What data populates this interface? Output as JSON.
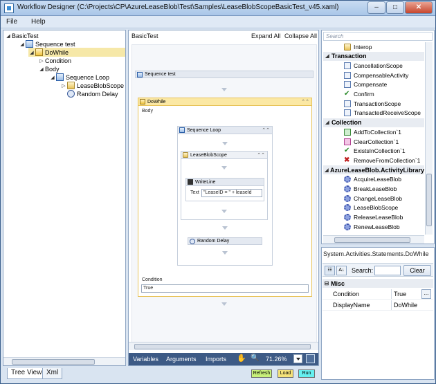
{
  "window": {
    "title": "Workflow Designer (C:\\Projects\\CP\\AzureLeaseBlob\\Test\\Samples\\LeaseBlobScopeBasicTest_v45.xaml)"
  },
  "window_controls": {
    "minimize": "–",
    "maximize": "□",
    "close": "✕"
  },
  "menu": [
    "File",
    "Help"
  ],
  "tree": {
    "items": [
      {
        "label": "BasicTest"
      },
      {
        "label": "Sequence test"
      },
      {
        "label": "DoWhile"
      },
      {
        "label": "Condition"
      },
      {
        "label": "Body"
      },
      {
        "label": "Sequence Loop"
      },
      {
        "label": "LeaseBlobScope"
      },
      {
        "label": "Random Delay"
      }
    ]
  },
  "tabs": [
    "Tree View",
    "Xml"
  ],
  "designer": {
    "breadcrumb": "BasicTest",
    "expand_all": "Expand All",
    "collapse_all": "Collapse All",
    "sequence_test": "Sequence test",
    "dowhile": "DoWhile",
    "body": "Body",
    "sequence_loop": "Sequence Loop",
    "lease_blob_scope": "LeaseBlobScope",
    "writeline": "WriteLine",
    "text_label": "Text",
    "text_value": "\"LeaseID = \" + leaseId",
    "random_delay": "Random Delay",
    "condition_label": "Condition",
    "condition_value": "True",
    "footer": {
      "variables": "Variables",
      "arguments": "Arguments",
      "imports": "Imports",
      "zoom": "71.26%"
    }
  },
  "toolbox": {
    "search_placeholder": "Search",
    "rows": [
      {
        "label": "Interop",
        "cat": false,
        "icon": "folder"
      },
      {
        "label": "Transaction",
        "cat": true
      },
      {
        "label": "CancellationScope",
        "cat": false,
        "icon": "page"
      },
      {
        "label": "CompensableActivity",
        "cat": false,
        "icon": "page"
      },
      {
        "label": "Compensate",
        "cat": false,
        "icon": "page"
      },
      {
        "label": "Confirm",
        "cat": false,
        "icon": "check"
      },
      {
        "label": "TransactionScope",
        "cat": false,
        "icon": "page"
      },
      {
        "label": "TransactedReceiveScope",
        "cat": false,
        "icon": "page"
      },
      {
        "label": "Collection",
        "cat": true
      },
      {
        "label": "AddToCollection`1",
        "cat": false,
        "icon": "plus"
      },
      {
        "label": "ClearCollection`1",
        "cat": false,
        "icon": "eraser"
      },
      {
        "label": "ExistsInCollection`1",
        "cat": false,
        "icon": "check"
      },
      {
        "label": "RemoveFromCollection`1",
        "cat": false,
        "icon": "x"
      },
      {
        "label": "AzureLeaseBlob.ActivityLibrary",
        "cat": true
      },
      {
        "label": "AcquireLeaseBlob",
        "cat": false,
        "icon": "gear"
      },
      {
        "label": "BreakLeaseBlob",
        "cat": false,
        "icon": "gear"
      },
      {
        "label": "ChangeLeaseBlob",
        "cat": false,
        "icon": "gear"
      },
      {
        "label": "LeaseBlobScope",
        "cat": false,
        "icon": "gear"
      },
      {
        "label": "ReleaseLeaseBlob",
        "cat": false,
        "icon": "gear"
      },
      {
        "label": "RenewLeaseBlob",
        "cat": false,
        "icon": "gear"
      }
    ]
  },
  "properties": {
    "title": "System.Activities.Statements.DoWhile",
    "search_label": "Search:",
    "clear": "Clear",
    "category": "Misc",
    "rows": [
      {
        "key": "Condition",
        "value": "True"
      },
      {
        "key": "DisplayName",
        "value": "DoWhile"
      }
    ]
  },
  "status_buttons": [
    {
      "label": "Refresh",
      "color": "#c8f07a"
    },
    {
      "label": "Load",
      "color": "#f5e27a"
    },
    {
      "label": "Run",
      "color": "#66f0f0"
    }
  ]
}
